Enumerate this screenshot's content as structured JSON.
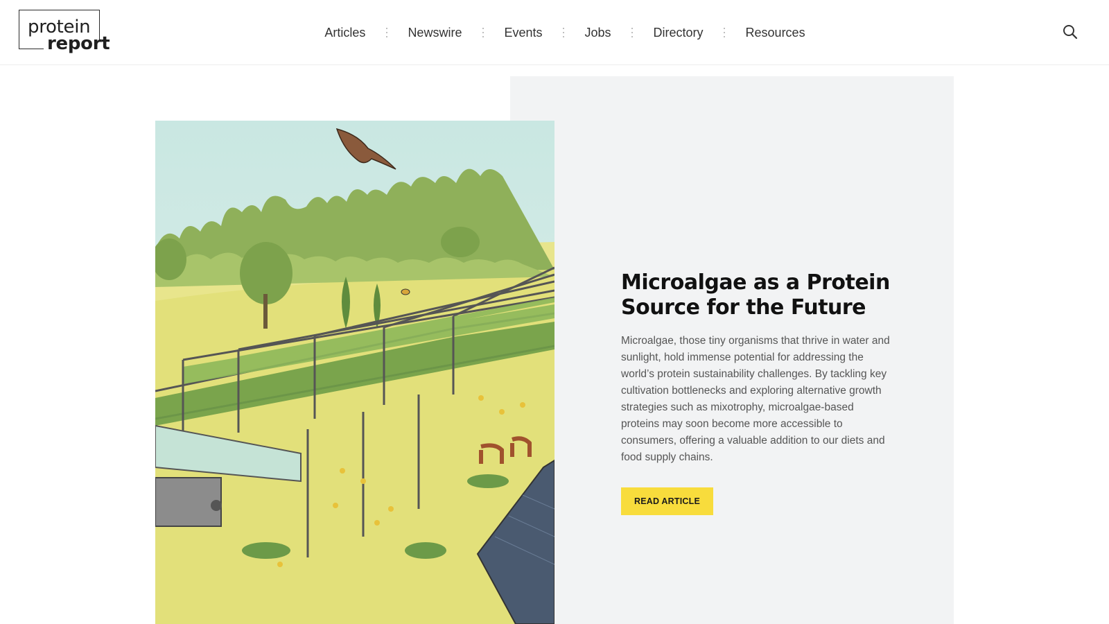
{
  "brand": {
    "logo_line1": "protein",
    "logo_line2": "report"
  },
  "nav": {
    "items": [
      {
        "label": "Articles"
      },
      {
        "label": "Newswire"
      },
      {
        "label": "Events"
      },
      {
        "label": "Jobs"
      },
      {
        "label": "Directory"
      },
      {
        "label": "Resources"
      }
    ],
    "search_icon": "search-icon"
  },
  "hero": {
    "title": "Microalgae as a Protein Source for the Future",
    "description": "Microalgae, those tiny organisms that thrive in water and sunlight, hold immense potential for addressing the world’s protein sustainability challenges. By tackling key cultivation bottlenecks and exploring alternative growth strategies such as mixotrophy, microalgae-based proteins may soon become more accessible to consumers, offering a valuable addition to our diets and food supply chains.",
    "cta_label": "READ ARTICLE"
  },
  "colors": {
    "accent": "#f8dc3c",
    "panel_bg": "#f2f3f4",
    "text_dark": "#111111"
  }
}
